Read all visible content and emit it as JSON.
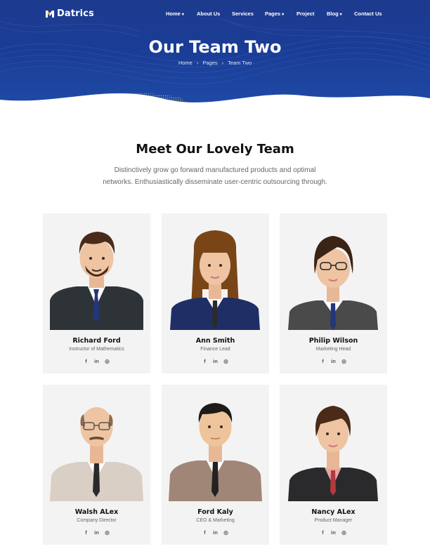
{
  "brand": {
    "name": "Datrics"
  },
  "nav": {
    "items": [
      {
        "label": "Home",
        "has_dropdown": true
      },
      {
        "label": "About Us",
        "has_dropdown": false
      },
      {
        "label": "Services",
        "has_dropdown": false
      },
      {
        "label": "Pages",
        "has_dropdown": true
      },
      {
        "label": "Project",
        "has_dropdown": false
      },
      {
        "label": "Blog",
        "has_dropdown": true
      },
      {
        "label": "Contact Us",
        "has_dropdown": false
      }
    ]
  },
  "hero": {
    "title": "Our Team Two",
    "breadcrumb": [
      "Home",
      "Pages",
      "Team Two"
    ]
  },
  "section": {
    "title": "Meet Our Lovely Team",
    "description": "Distinctively grow go forward manufactured products and optimal networks. Enthusiastically disseminate user-centric outsourcing through."
  },
  "team": [
    {
      "name": "Richard Ford",
      "role": "Instructor of Mathematics",
      "social": [
        "facebook-icon",
        "linkedin-icon",
        "dribbble-icon"
      ]
    },
    {
      "name": "Ann Smith",
      "role": "Finance Lead",
      "social": [
        "facebook-icon",
        "linkedin-icon",
        "dribbble-icon"
      ]
    },
    {
      "name": "Philip Wilson",
      "role": "Marketing Head",
      "social": [
        "facebook-icon",
        "linkedin-icon",
        "dribbble-icon"
      ]
    },
    {
      "name": "Walsh ALex",
      "role": "Company Director",
      "social": [
        "facebook-icon",
        "linkedin-icon",
        "dribbble-icon"
      ]
    },
    {
      "name": "Ford Kaly",
      "role": "CEO & Marketing",
      "social": [
        "facebook-icon",
        "linkedin-icon",
        "dribbble-icon"
      ]
    },
    {
      "name": "Nancy ALex",
      "role": "Product Manager",
      "social": [
        "facebook-icon",
        "linkedin-icon",
        "dribbble-icon"
      ]
    }
  ],
  "social_glyphs": {
    "facebook": "f",
    "linkedin": "in",
    "dribbble": "◎"
  },
  "colors": {
    "hero_blue": "#1d3b8e",
    "card_bg": "#f3f3f3",
    "accent_gold": "#e2b23a"
  }
}
